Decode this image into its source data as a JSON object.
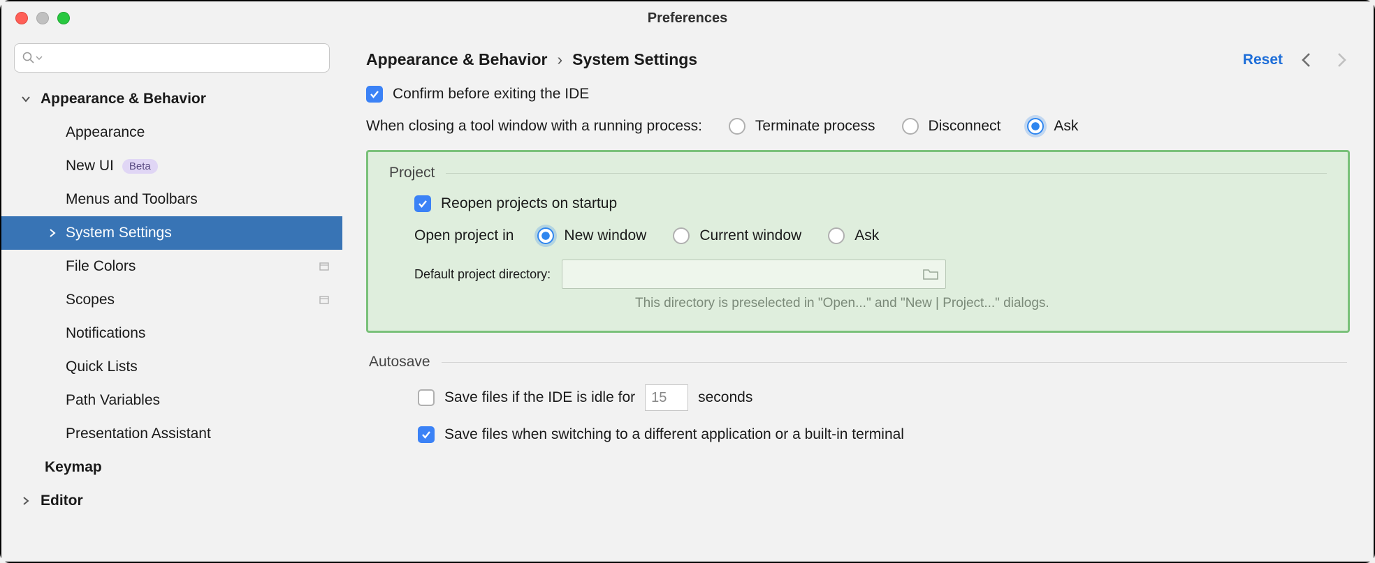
{
  "window": {
    "title": "Preferences"
  },
  "sidebar": {
    "search_placeholder": "",
    "items": [
      {
        "label": "Appearance & Behavior",
        "level": 1,
        "expandable": true
      },
      {
        "label": "Appearance",
        "level": 2
      },
      {
        "label": "New UI",
        "level": 2,
        "badge": "Beta"
      },
      {
        "label": "Menus and Toolbars",
        "level": 2
      },
      {
        "label": "System Settings",
        "level": 2,
        "selected": true,
        "expandable": true
      },
      {
        "label": "File Colors",
        "level": 2,
        "trailing": true
      },
      {
        "label": "Scopes",
        "level": 2,
        "trailing": true
      },
      {
        "label": "Notifications",
        "level": 2
      },
      {
        "label": "Quick Lists",
        "level": 2
      },
      {
        "label": "Path Variables",
        "level": 2
      },
      {
        "label": "Presentation Assistant",
        "level": 2
      },
      {
        "label": "Keymap",
        "level": 1
      },
      {
        "label": "Editor",
        "level": 1,
        "expandable": true
      }
    ]
  },
  "header": {
    "breadcrumb": [
      "Appearance & Behavior",
      "System Settings"
    ],
    "reset": "Reset"
  },
  "settings": {
    "confirm_exit_label": "Confirm before exiting the IDE",
    "closing_tool_label": "When closing a tool window with a running process:",
    "closing_options": {
      "terminate": "Terminate process",
      "disconnect": "Disconnect",
      "ask": "Ask"
    },
    "project": {
      "title": "Project",
      "reopen_label": "Reopen projects on startup",
      "open_in_label": "Open project in",
      "open_options": {
        "new_window": "New window",
        "current_window": "Current window",
        "ask": "Ask"
      },
      "default_dir_label": "Default project directory:",
      "default_dir_value": "",
      "hint": "This directory is preselected in \"Open...\" and \"New | Project...\" dialogs."
    },
    "autosave": {
      "title": "Autosave",
      "idle_prefix": "Save files if the IDE is idle for",
      "idle_value": "15",
      "idle_suffix": "seconds",
      "switch_label": "Save files when switching to a different application or a built-in terminal"
    }
  }
}
